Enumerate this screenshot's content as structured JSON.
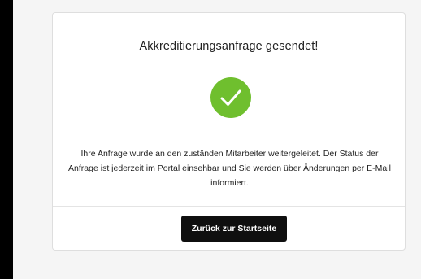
{
  "card": {
    "title": "Akkreditierungsanfrage gesendet!",
    "status_icon": "check-circle-icon",
    "message": "Ihre Anfrage wurde an den zuständen Mitarbeiter weitergeleitet. Der Status der Anfrage ist jederzeit im Portal einsehbar und Sie werden über Änderungen per E-Mail informiert.",
    "back_button_label": "Zurück zur Startseite"
  },
  "colors": {
    "success": "#6fbf2e",
    "button_bg": "#0f0f0f",
    "button_text": "#ffffff",
    "page_bg": "#f5f5f5",
    "card_bg": "#ffffff"
  }
}
